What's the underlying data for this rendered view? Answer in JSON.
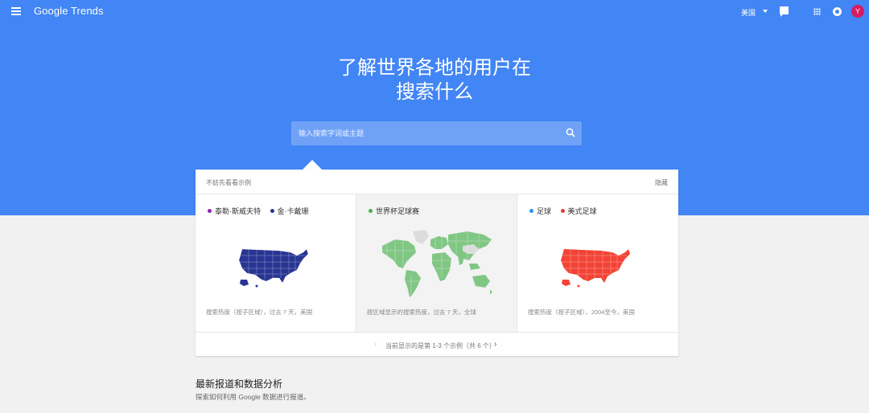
{
  "header": {
    "logo": "Google Trends",
    "region": "美国",
    "avatar_letter": "Y",
    "icons": [
      "menu-icon",
      "caret-down-icon",
      "feedback-icon",
      "apps-icon",
      "notifications-icon",
      "avatar"
    ]
  },
  "hero": {
    "title_line1": "了解世界各地的用户在",
    "title_line2": "搜索什么"
  },
  "search": {
    "placeholder": "输入搜索字词或主题"
  },
  "examples": {
    "tip": "不妨先看看示例",
    "close_label": "隐藏",
    "panels": [
      {
        "legend": [
          {
            "label": "泰勒·斯威夫特",
            "color": "#8e24aa"
          },
          {
            "label": "金·卡戴珊",
            "color": "#283593"
          }
        ],
        "map": "us-map",
        "map_color": "#283593",
        "caption": "搜索热度（按子区域），过去 7 天，美国"
      },
      {
        "legend": [
          {
            "label": "世界杯足球赛",
            "color": "#4caf50"
          }
        ],
        "map": "world-map",
        "map_color": "#81c784",
        "caption": "按区域显示的搜索热度，过去 7 天，全球"
      },
      {
        "legend": [
          {
            "label": "足球",
            "color": "#2196f3"
          },
          {
            "label": "美式足球",
            "color": "#e53935"
          }
        ],
        "map": "us-map",
        "map_color": "#f44336",
        "caption": "搜索热度（按子区域），2004至今，美国"
      }
    ],
    "footer_status": "当前显示的是第 1-3 个示例（共 6 个）"
  },
  "latest": {
    "title": "最新报道和数据分析",
    "subtitle": "探索如何利用 Google 数据进行报道。"
  }
}
